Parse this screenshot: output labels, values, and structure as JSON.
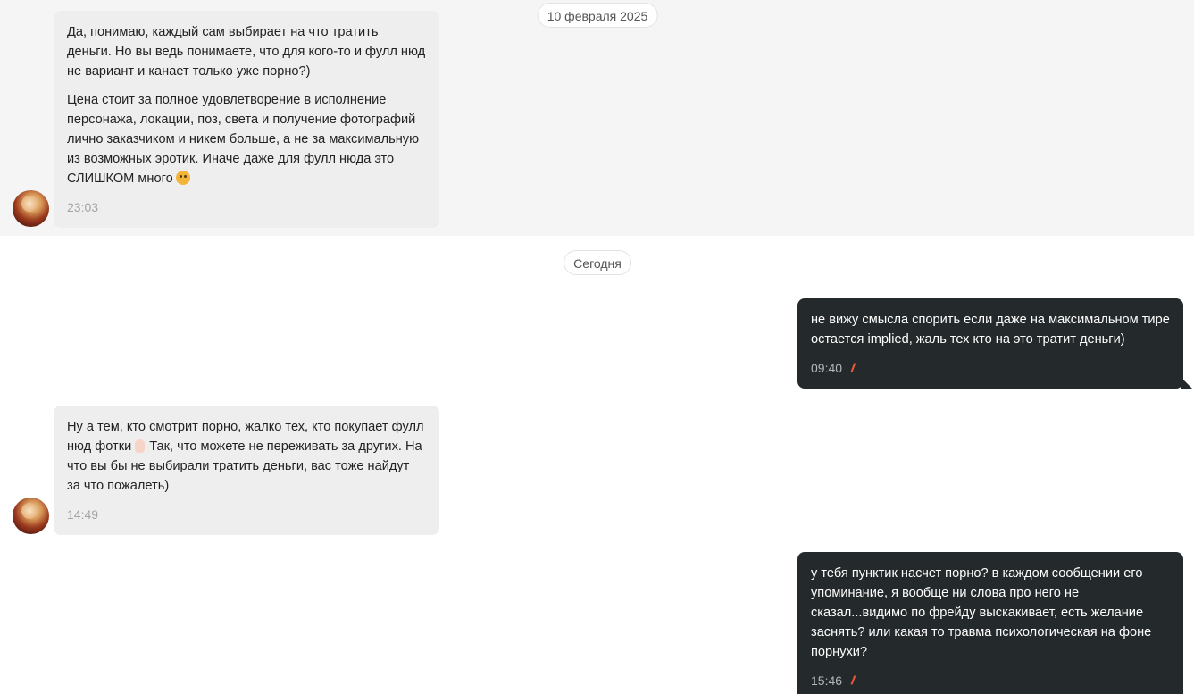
{
  "dates": {
    "old": "10 февраля 2025",
    "today": "Сегодня"
  },
  "messages": [
    {
      "side": "incoming",
      "paragraphs": [
        "Да, понимаю, каждый сам выбирает на что тратить деньги. Но вы ведь понимаете, что для кого-то и фулл нюд не вариант и канает только уже порно?)",
        "Цена стоит за полное удовлетворение в исполнение персонажа, локации, поз, света и получение фотографий лично заказчиком и никем больше, а не за максимальную из возможных эротик. Иначе даже для фулл нюда это СЛИШКОМ много"
      ],
      "emoji": "thinking-face",
      "time": "23:03"
    },
    {
      "side": "outgoing",
      "text": "не вижу смысла спорить если даже на максимальном тире остается implied, жаль тех кто на это тратит деньги)",
      "time": "09:40",
      "status_icon": "double-check-read"
    },
    {
      "side": "incoming",
      "text_before_emoji": "Ну а тем, кто смотрит порно, жалко тех, кто покупает фулл нюд фотки",
      "emoji": "raised-hand",
      "text_after_emoji": "Так, что можете не переживать за других. На что вы бы не выбирали тратить деньги, вас тоже найдут за что пожалеть)",
      "time": "14:49"
    },
    {
      "side": "outgoing",
      "text": "у тебя пунктик насчет порно? в каждом сообщении его упоминание, я вообще ни слова про него не сказал...видимо по фрейду выскакивает, есть желание заснять? или какая то травма психологическая на фоне порнухи?",
      "time": "15:46",
      "status_icon": "double-check-read"
    }
  ],
  "colors": {
    "incoming_bg": "#eeeeee",
    "outgoing_bg": "#242a2b",
    "read_check": "#e8583a",
    "old_band_bg": "#f5f5f5"
  }
}
